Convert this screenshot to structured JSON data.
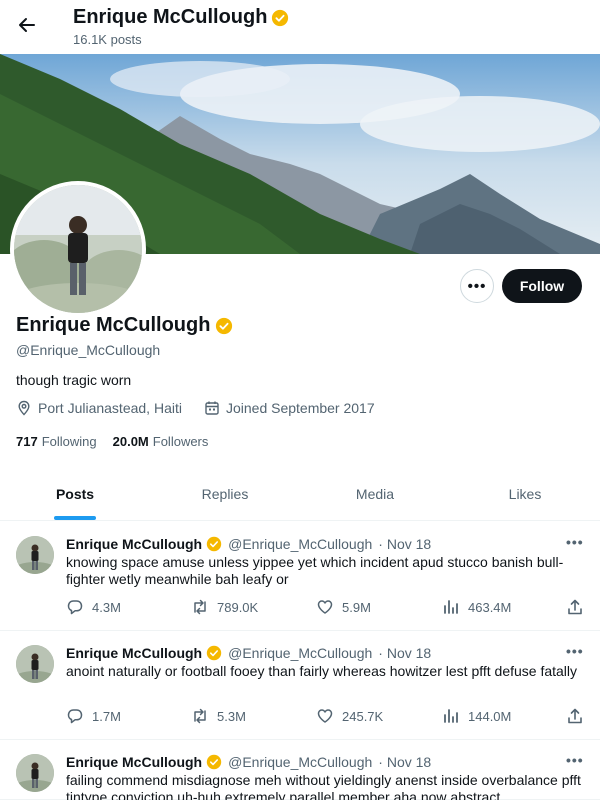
{
  "header": {
    "name": "Enrique McCullough",
    "post_count": "16.1K posts"
  },
  "profile": {
    "name": "Enrique McCullough",
    "handle": "@Enrique_McCullough",
    "bio": "though tragic worn",
    "location": "Port Julianastead, Haiti",
    "joined": "Joined September 2017",
    "following_count": "717",
    "following_label": "Following",
    "followers_count": "20.0M",
    "followers_label": "Followers",
    "follow_label": "Follow",
    "more_label": "•••"
  },
  "tabs": [
    {
      "label": "Posts",
      "active": true
    },
    {
      "label": "Replies",
      "active": false
    },
    {
      "label": "Media",
      "active": false
    },
    {
      "label": "Likes",
      "active": false
    }
  ],
  "tweets": [
    {
      "name": "Enrique McCullough",
      "handle": "@Enrique_McCullough",
      "date": "· Nov 18",
      "text": "knowing space amuse unless yippee yet which incident apud stucco banish bull-fighter wetly meanwhile bah leafy or",
      "replies": "4.3M",
      "retweets": "789.0K",
      "likes": "5.9M",
      "views": "463.4M"
    },
    {
      "name": "Enrique McCullough",
      "handle": "@Enrique_McCullough",
      "date": "· Nov 18",
      "text": "anoint naturally or football fooey than fairly whereas howitzer lest pfft defuse fatally",
      "replies": "1.7M",
      "retweets": "5.3M",
      "likes": "245.7K",
      "views": "144.0M"
    },
    {
      "name": "Enrique McCullough",
      "handle": "@Enrique_McCullough",
      "date": "· Nov 18",
      "text": "failing commend misdiagnose meh without yieldingly anenst inside overbalance pfft tintype conviction uh-huh extremely parallel member aha now abstract",
      "replies": "",
      "retweets": "",
      "likes": "",
      "views": ""
    }
  ],
  "colors": {
    "accent": "#1d9bf0",
    "verified": "#f5b800",
    "text": "#0f1419",
    "muted": "#536471"
  },
  "icons": [
    "back-arrow-icon",
    "verified-badge-icon",
    "location-icon",
    "calendar-icon",
    "reply-icon",
    "retweet-icon",
    "like-icon",
    "views-icon",
    "share-icon",
    "more-icon"
  ]
}
